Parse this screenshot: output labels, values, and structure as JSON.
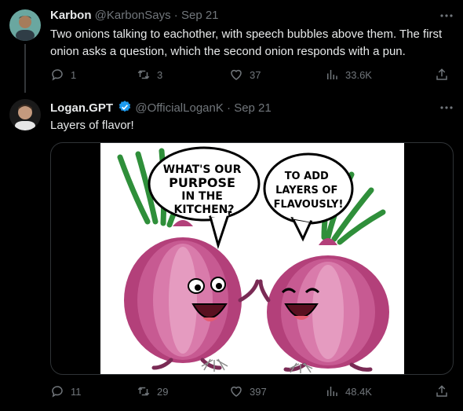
{
  "tweets": [
    {
      "name": "Karbon",
      "handle": "@KarbonSays",
      "sep": "·",
      "date": "Sep 21",
      "text": "Two onions talking to eachother, with speech bubbles above them. The first onion asks a question, which the second onion responds with a pun.",
      "replies": "1",
      "retweets": "3",
      "likes": "37",
      "views": "33.6K"
    },
    {
      "name": "Logan.GPT",
      "handle": "@OfficialLoganK",
      "sep": "·",
      "date": "Sep 21",
      "text": "Layers of flavor!",
      "replies": "11",
      "retweets": "29",
      "likes": "397",
      "views": "48.4K",
      "media": {
        "bubble_left": [
          "WHAT'S OUR",
          "PURPOSE",
          "IN THE",
          "KITCHEN?"
        ],
        "bubble_right": [
          "TO ADD",
          "LAYERS OF",
          "FLAVOUSLY!"
        ]
      }
    }
  ],
  "colors": {
    "background": "#000000",
    "text": "#e7e9ea",
    "muted": "#71767b",
    "verified": "#1d9bf0"
  },
  "icons": [
    "more-icon",
    "reply-icon",
    "retweet-icon",
    "like-icon",
    "views-icon",
    "share-icon",
    "verified-icon"
  ]
}
